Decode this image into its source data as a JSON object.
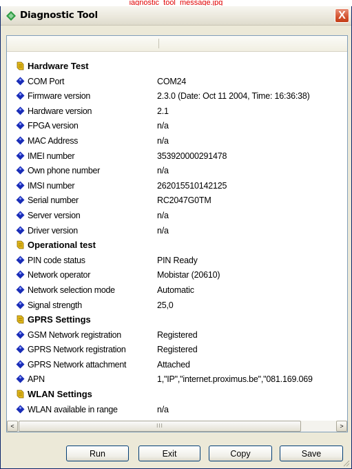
{
  "top_file": "iagnostic_tool_message.jpg",
  "window": {
    "title": "Diagnostic Tool",
    "close_label": "X"
  },
  "colors": {
    "title_accent": "#2e9b43",
    "close": "#d4532f",
    "diamond": "#1a2db8",
    "section_icon": "#e2b81b"
  },
  "rows": [
    {
      "type": "section",
      "key": "Hardware Test",
      "value": ""
    },
    {
      "type": "item",
      "key": "COM Port",
      "value": "COM24"
    },
    {
      "type": "item",
      "key": "Firmware version",
      "value": "2.3.0  (Date: Oct 11 2004, Time: 16:36:38)"
    },
    {
      "type": "item",
      "key": "Hardware version",
      "value": "2.1"
    },
    {
      "type": "item",
      "key": "FPGA version",
      "value": "n/a"
    },
    {
      "type": "item",
      "key": "MAC Address",
      "value": "n/a"
    },
    {
      "type": "item",
      "key": "IMEI number",
      "value": "353920000291478"
    },
    {
      "type": "item",
      "key": "Own phone number",
      "value": "n/a"
    },
    {
      "type": "item",
      "key": "IMSI number",
      "value": "262015510142125"
    },
    {
      "type": "item",
      "key": "Serial number",
      "value": "RC2047G0TM"
    },
    {
      "type": "item",
      "key": "Server version",
      "value": "n/a"
    },
    {
      "type": "item",
      "key": "Driver version",
      "value": "n/a"
    },
    {
      "type": "section",
      "key": "Operational test",
      "value": ""
    },
    {
      "type": "item",
      "key": "PIN code status",
      "value": "PIN Ready"
    },
    {
      "type": "item",
      "key": "Network operator",
      "value": "Mobistar (20610)"
    },
    {
      "type": "item",
      "key": "Network selection mode",
      "value": "Automatic"
    },
    {
      "type": "item",
      "key": "Signal strength",
      "value": "25,0"
    },
    {
      "type": "section",
      "key": "GPRS Settings",
      "value": ""
    },
    {
      "type": "item",
      "key": "GSM Network registration",
      "value": "Registered"
    },
    {
      "type": "item",
      "key": "GPRS Network registration",
      "value": "Registered"
    },
    {
      "type": "item",
      "key": "GPRS Network attachment",
      "value": "Attached"
    },
    {
      "type": "item",
      "key": "APN",
      "value": "1,\"IP\",\"internet.proximus.be\",\"081.169.069"
    },
    {
      "type": "section",
      "key": "WLAN Settings",
      "value": ""
    },
    {
      "type": "item",
      "key": "WLAN available in range",
      "value": "n/a"
    }
  ],
  "scrollbar": {
    "left_arrow": "<",
    "right_arrow": ">",
    "thumb_grip": "III"
  },
  "buttons": {
    "run": "Run",
    "exit": "Exit",
    "copy": "Copy",
    "save": "Save"
  }
}
